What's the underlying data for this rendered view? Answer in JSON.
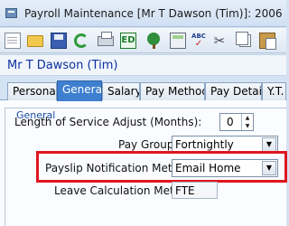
{
  "window": {
    "title": "Payroll Maintenance  [Mr T Dawson (Tim)]:  2006"
  },
  "toolbar": {
    "buttons": [
      {
        "name": "new-icon"
      },
      {
        "name": "open-folder-icon"
      },
      {
        "name": "save-icon"
      },
      {
        "name": "refresh-icon"
      },
      {
        "name": "print-icon"
      },
      {
        "name": "ed-icon",
        "text": "ED"
      },
      {
        "name": "tree-icon"
      },
      {
        "name": "calculator-icon"
      },
      {
        "name": "spellcheck-icon",
        "text": "ABC"
      },
      {
        "name": "cut-icon"
      },
      {
        "name": "copy-icon"
      },
      {
        "name": "paste-icon"
      }
    ]
  },
  "employee": {
    "name": "Mr T Dawson (Tim)"
  },
  "tabs": [
    {
      "label": "Personal",
      "active": false
    },
    {
      "label": "General",
      "active": true
    },
    {
      "label": "Salary",
      "active": false
    },
    {
      "label": "Pay Methods",
      "active": false
    },
    {
      "label": "Pay Details",
      "active": false
    },
    {
      "label": "Y.T.",
      "active": false
    }
  ],
  "general": {
    "legend": "General",
    "length_of_service_label": "Length of Service Adjust (Months):",
    "length_of_service_value": "0",
    "pay_group_label": "Pay Group:",
    "pay_group_value": "Fortnightly",
    "payslip_notification_label": "Payslip Notification Method:",
    "payslip_notification_value": "Email Home",
    "leave_calc_label": "Leave Calculation Method:",
    "leave_calc_value": "FTE"
  },
  "colors": {
    "accent": "#3f7fd0",
    "highlight": "#e0161f",
    "employee_name": "#0d2fa0"
  }
}
